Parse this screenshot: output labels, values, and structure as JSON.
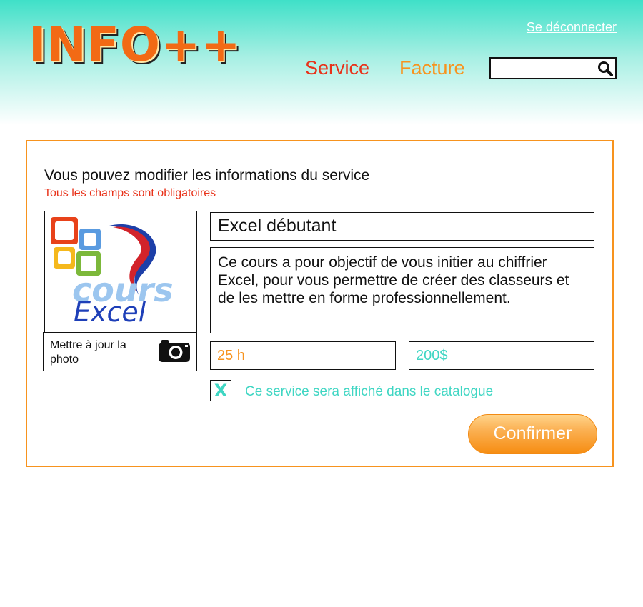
{
  "header": {
    "logo_text": "INFO++",
    "logout_label": "Se déconnecter",
    "nav": {
      "service_label": "Service",
      "facture_label": "Facture"
    },
    "search": {
      "value": "",
      "placeholder": "",
      "icon": "search-icon"
    }
  },
  "form": {
    "heading": "Vous pouvez modifier les informations du service",
    "required_note": "Tous les champs sont obligatoires",
    "photo": {
      "logo_word": "cours",
      "logo_word2": "Excel",
      "update_label": "Mettre à jour la photo",
      "icon": "camera-icon"
    },
    "title_value": "Excel débutant",
    "description_value": "Ce cours a pour objectif de vous initier au chiffrier Excel, pour vous permettre de créer des classeurs et de les mettre en forme professionnellement.",
    "duration_value": "25 h",
    "price_value": "200$",
    "catalog": {
      "checked_mark": "X",
      "label": "Ce service sera affiché dans le catalogue"
    },
    "confirm_label": "Confirmer"
  },
  "colors": {
    "accent_orange": "#f7931e",
    "accent_red": "#e8321a",
    "accent_teal": "#3fd6c3"
  }
}
